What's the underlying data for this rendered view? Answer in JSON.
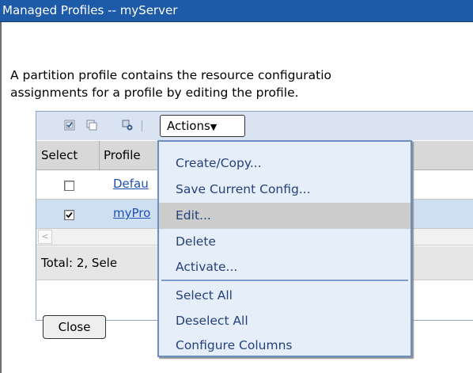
{
  "window": {
    "title": "Managed Profiles -- myServer"
  },
  "description": {
    "line1": "A partition profile contains the resource configuratio",
    "line2": "assignments for a profile by editing the profile."
  },
  "toolbar": {
    "actions_label": "Actions",
    "actions_arrow": "▼"
  },
  "table": {
    "headers": {
      "select": "Select",
      "profile": "Profile"
    },
    "rows": [
      {
        "selected": false,
        "name": "Defau"
      },
      {
        "selected": true,
        "name": "myPro"
      }
    ],
    "footer": "Total: 2, Sele"
  },
  "menu": {
    "items": [
      {
        "label": "Create/Copy..."
      },
      {
        "label": "Save Current Config..."
      },
      {
        "label": "Edit..."
      },
      {
        "label": "Delete"
      },
      {
        "label": "Activate..."
      },
      {
        "label": "Select All"
      },
      {
        "label": "Deselect All"
      },
      {
        "label": "Configure Columns"
      }
    ],
    "highlighted_index": 2
  },
  "buttons": {
    "close": "Close"
  },
  "colors": {
    "title_bar": "#1d5ba8",
    "selected_row": "#cfdff2",
    "menu_bg": "#e6eef9",
    "link": "#1e4fb5"
  },
  "icons": [
    "select-all-icon",
    "copy-icon",
    "filter-icon",
    "checkbox-checked-icon",
    "scroll-left-icon"
  ]
}
